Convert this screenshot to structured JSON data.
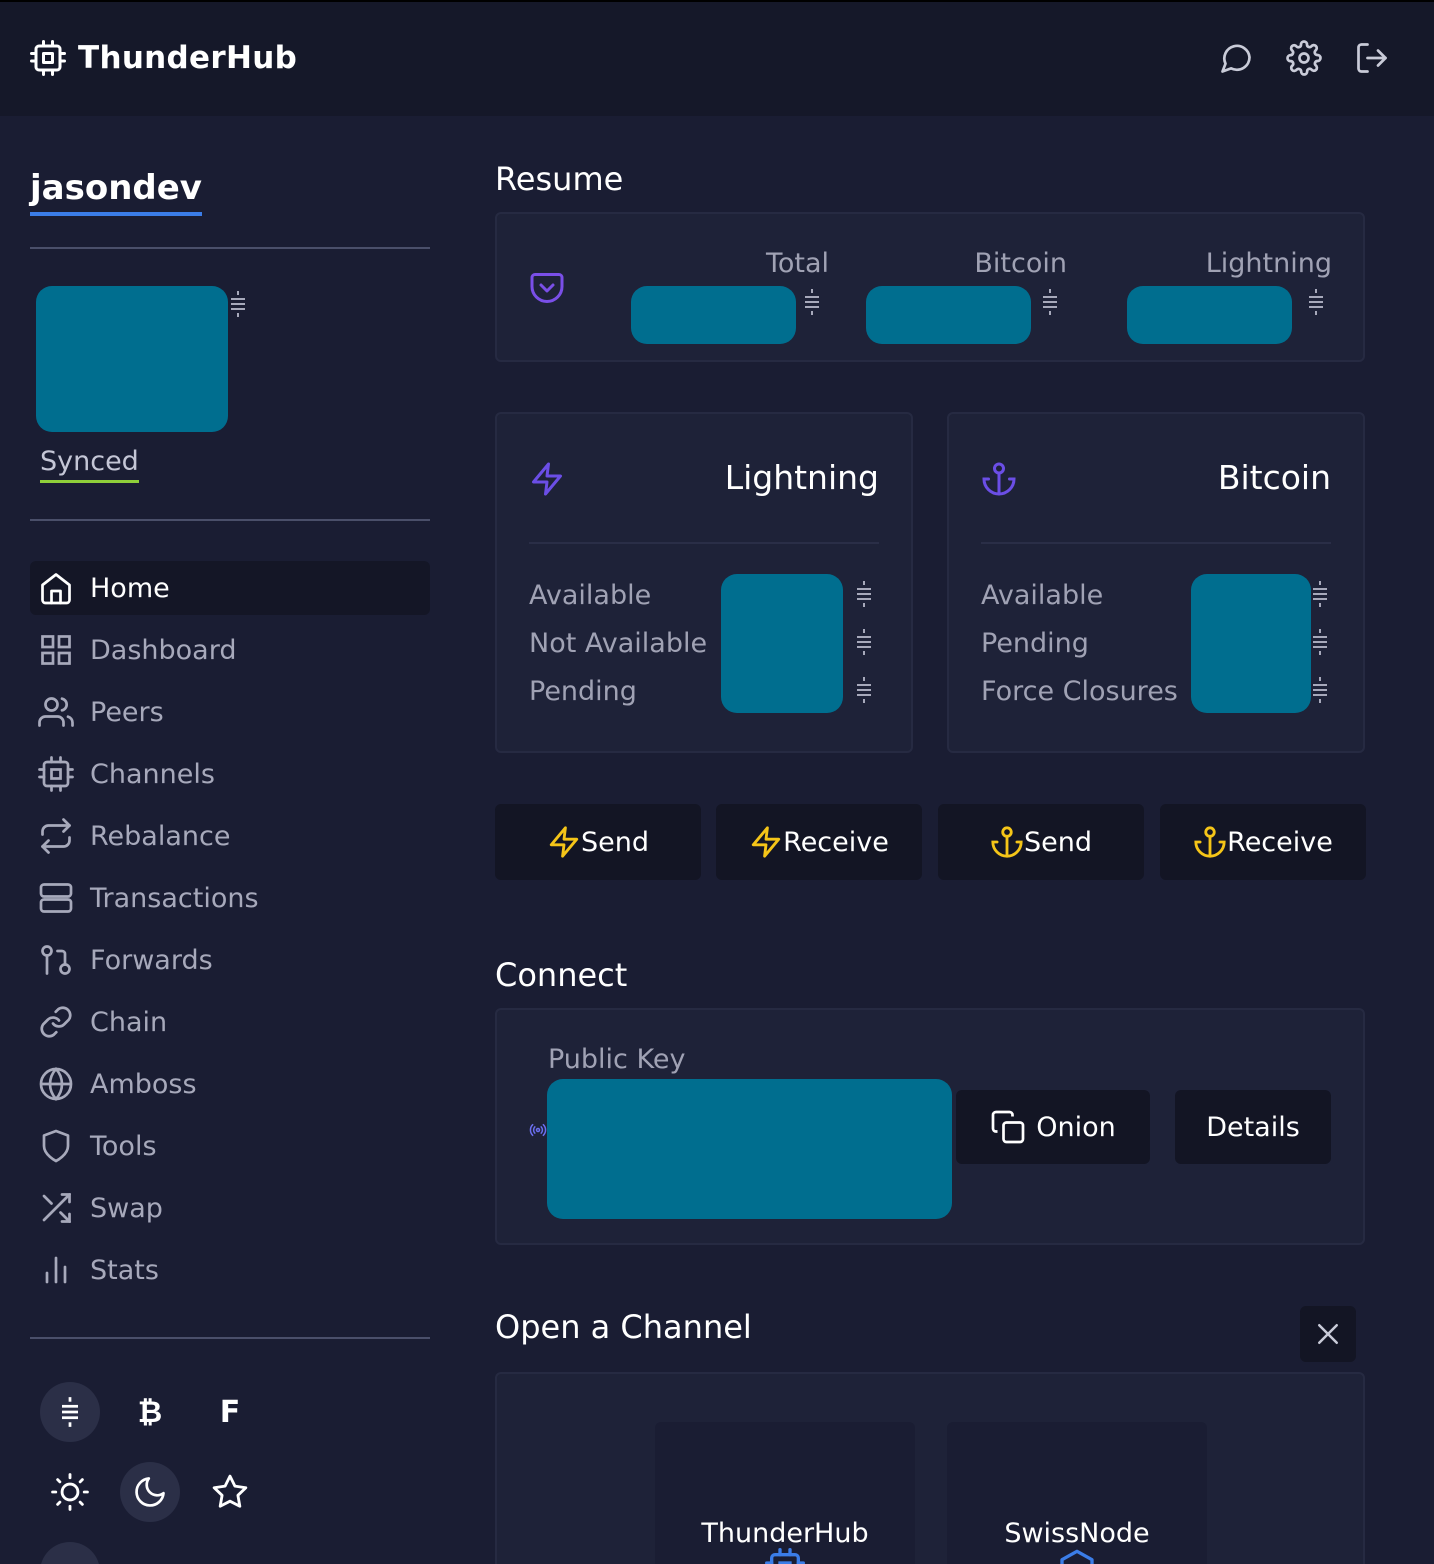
{
  "app": {
    "name": "ThunderHub"
  },
  "header": {
    "icons": [
      "chat-icon",
      "settings-icon",
      "logout-icon"
    ]
  },
  "sidebar": {
    "node_alias": "jasondev",
    "sync_status": "Synced",
    "nav": [
      {
        "label": "Home",
        "icon": "home-icon",
        "active": true
      },
      {
        "label": "Dashboard",
        "icon": "dashboard-icon",
        "active": false
      },
      {
        "label": "Peers",
        "icon": "peers-icon",
        "active": false
      },
      {
        "label": "Channels",
        "icon": "channels-icon",
        "active": false
      },
      {
        "label": "Rebalance",
        "icon": "rebalance-icon",
        "active": false
      },
      {
        "label": "Transactions",
        "icon": "transactions-icon",
        "active": false
      },
      {
        "label": "Forwards",
        "icon": "forwards-icon",
        "active": false
      },
      {
        "label": "Chain",
        "icon": "chain-icon",
        "active": false
      },
      {
        "label": "Amboss",
        "icon": "globe-icon",
        "active": false
      },
      {
        "label": "Tools",
        "icon": "shield-icon",
        "active": false
      },
      {
        "label": "Swap",
        "icon": "shuffle-icon",
        "active": false
      },
      {
        "label": "Stats",
        "icon": "stats-icon",
        "active": false
      }
    ],
    "currency_options": [
      {
        "glyph": "≡",
        "name": "sats",
        "selected": true
      },
      {
        "glyph": "₿",
        "name": "btc",
        "selected": false
      },
      {
        "glyph": "F",
        "name": "fiat",
        "selected": false
      }
    ],
    "theme_options": [
      {
        "icon": "sun-icon",
        "selected": false
      },
      {
        "icon": "moon-icon",
        "selected": true
      },
      {
        "icon": "star-icon",
        "selected": false
      }
    ]
  },
  "resume": {
    "title": "Resume",
    "labels": {
      "total": "Total",
      "bitcoin": "Bitcoin",
      "lightning": "Lightning"
    }
  },
  "lightning_card": {
    "title": "Lightning",
    "rows": [
      "Available",
      "Not Available",
      "Pending"
    ]
  },
  "bitcoin_card": {
    "title": "Bitcoin",
    "rows": [
      "Available",
      "Pending",
      "Force Closures"
    ]
  },
  "actions": [
    {
      "label": "Send",
      "icon": "lightning-icon"
    },
    {
      "label": "Receive",
      "icon": "lightning-icon"
    },
    {
      "label": "Send",
      "icon": "anchor-icon"
    },
    {
      "label": "Receive",
      "icon": "anchor-icon"
    }
  ],
  "connect": {
    "title": "Connect",
    "public_key_label": "Public Key",
    "onion_label": "Onion",
    "details_label": "Details"
  },
  "open_channel": {
    "title": "Open a Channel",
    "providers": [
      "ThunderHub",
      "SwissNode"
    ]
  },
  "colors": {
    "accent_blue": "#3b7de8",
    "synced_green": "#8fcf3a",
    "lightning_yellow": "#f5c518",
    "icon_purple": "#6b4ee6",
    "redaction": "#006e8f"
  }
}
